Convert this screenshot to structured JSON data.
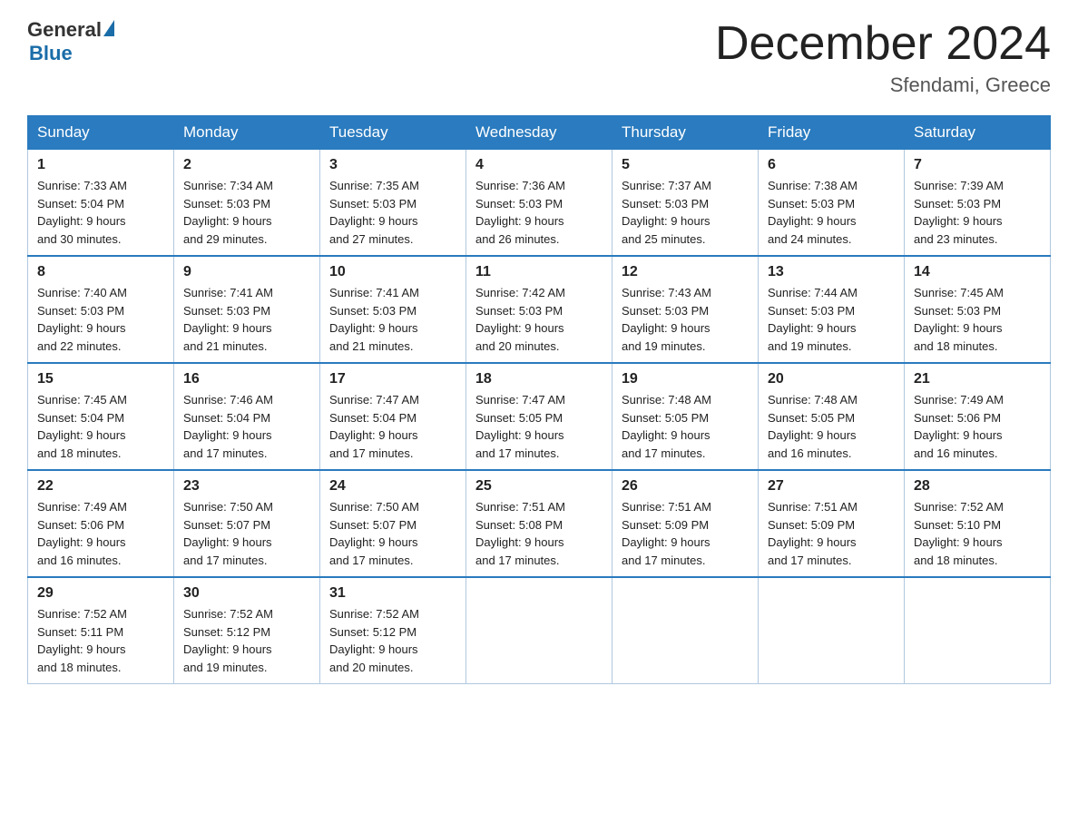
{
  "logo": {
    "general": "General",
    "blue": "Blue"
  },
  "title": "December 2024",
  "subtitle": "Sfendami, Greece",
  "days_of_week": [
    "Sunday",
    "Monday",
    "Tuesday",
    "Wednesday",
    "Thursday",
    "Friday",
    "Saturday"
  ],
  "weeks": [
    [
      {
        "day": "1",
        "sunrise": "7:33 AM",
        "sunset": "5:04 PM",
        "daylight": "9 hours and 30 minutes."
      },
      {
        "day": "2",
        "sunrise": "7:34 AM",
        "sunset": "5:03 PM",
        "daylight": "9 hours and 29 minutes."
      },
      {
        "day": "3",
        "sunrise": "7:35 AM",
        "sunset": "5:03 PM",
        "daylight": "9 hours and 27 minutes."
      },
      {
        "day": "4",
        "sunrise": "7:36 AM",
        "sunset": "5:03 PM",
        "daylight": "9 hours and 26 minutes."
      },
      {
        "day": "5",
        "sunrise": "7:37 AM",
        "sunset": "5:03 PM",
        "daylight": "9 hours and 25 minutes."
      },
      {
        "day": "6",
        "sunrise": "7:38 AM",
        "sunset": "5:03 PM",
        "daylight": "9 hours and 24 minutes."
      },
      {
        "day": "7",
        "sunrise": "7:39 AM",
        "sunset": "5:03 PM",
        "daylight": "9 hours and 23 minutes."
      }
    ],
    [
      {
        "day": "8",
        "sunrise": "7:40 AM",
        "sunset": "5:03 PM",
        "daylight": "9 hours and 22 minutes."
      },
      {
        "day": "9",
        "sunrise": "7:41 AM",
        "sunset": "5:03 PM",
        "daylight": "9 hours and 21 minutes."
      },
      {
        "day": "10",
        "sunrise": "7:41 AM",
        "sunset": "5:03 PM",
        "daylight": "9 hours and 21 minutes."
      },
      {
        "day": "11",
        "sunrise": "7:42 AM",
        "sunset": "5:03 PM",
        "daylight": "9 hours and 20 minutes."
      },
      {
        "day": "12",
        "sunrise": "7:43 AM",
        "sunset": "5:03 PM",
        "daylight": "9 hours and 19 minutes."
      },
      {
        "day": "13",
        "sunrise": "7:44 AM",
        "sunset": "5:03 PM",
        "daylight": "9 hours and 19 minutes."
      },
      {
        "day": "14",
        "sunrise": "7:45 AM",
        "sunset": "5:03 PM",
        "daylight": "9 hours and 18 minutes."
      }
    ],
    [
      {
        "day": "15",
        "sunrise": "7:45 AM",
        "sunset": "5:04 PM",
        "daylight": "9 hours and 18 minutes."
      },
      {
        "day": "16",
        "sunrise": "7:46 AM",
        "sunset": "5:04 PM",
        "daylight": "9 hours and 17 minutes."
      },
      {
        "day": "17",
        "sunrise": "7:47 AM",
        "sunset": "5:04 PM",
        "daylight": "9 hours and 17 minutes."
      },
      {
        "day": "18",
        "sunrise": "7:47 AM",
        "sunset": "5:05 PM",
        "daylight": "9 hours and 17 minutes."
      },
      {
        "day": "19",
        "sunrise": "7:48 AM",
        "sunset": "5:05 PM",
        "daylight": "9 hours and 17 minutes."
      },
      {
        "day": "20",
        "sunrise": "7:48 AM",
        "sunset": "5:05 PM",
        "daylight": "9 hours and 16 minutes."
      },
      {
        "day": "21",
        "sunrise": "7:49 AM",
        "sunset": "5:06 PM",
        "daylight": "9 hours and 16 minutes."
      }
    ],
    [
      {
        "day": "22",
        "sunrise": "7:49 AM",
        "sunset": "5:06 PM",
        "daylight": "9 hours and 16 minutes."
      },
      {
        "day": "23",
        "sunrise": "7:50 AM",
        "sunset": "5:07 PM",
        "daylight": "9 hours and 17 minutes."
      },
      {
        "day": "24",
        "sunrise": "7:50 AM",
        "sunset": "5:07 PM",
        "daylight": "9 hours and 17 minutes."
      },
      {
        "day": "25",
        "sunrise": "7:51 AM",
        "sunset": "5:08 PM",
        "daylight": "9 hours and 17 minutes."
      },
      {
        "day": "26",
        "sunrise": "7:51 AM",
        "sunset": "5:09 PM",
        "daylight": "9 hours and 17 minutes."
      },
      {
        "day": "27",
        "sunrise": "7:51 AM",
        "sunset": "5:09 PM",
        "daylight": "9 hours and 17 minutes."
      },
      {
        "day": "28",
        "sunrise": "7:52 AM",
        "sunset": "5:10 PM",
        "daylight": "9 hours and 18 minutes."
      }
    ],
    [
      {
        "day": "29",
        "sunrise": "7:52 AM",
        "sunset": "5:11 PM",
        "daylight": "9 hours and 18 minutes."
      },
      {
        "day": "30",
        "sunrise": "7:52 AM",
        "sunset": "5:12 PM",
        "daylight": "9 hours and 19 minutes."
      },
      {
        "day": "31",
        "sunrise": "7:52 AM",
        "sunset": "5:12 PM",
        "daylight": "9 hours and 20 minutes."
      },
      null,
      null,
      null,
      null
    ]
  ],
  "labels": {
    "sunrise": "Sunrise:",
    "sunset": "Sunset:",
    "daylight": "Daylight:"
  }
}
